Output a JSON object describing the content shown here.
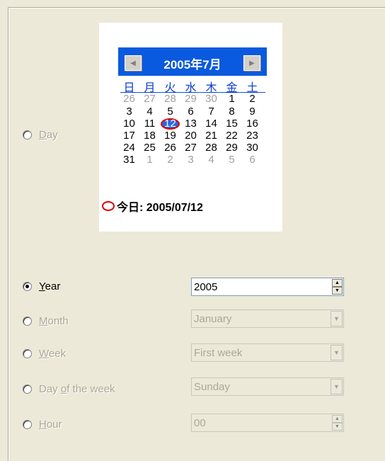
{
  "calendar": {
    "title": "2005年7月",
    "prev_icon": "left-arrow",
    "next_icon": "right-arrow",
    "weekdays": [
      "日",
      "月",
      "火",
      "水",
      "木",
      "金",
      "土"
    ],
    "weeks": [
      [
        "26",
        "27",
        "28",
        "29",
        "30",
        "1",
        "2"
      ],
      [
        "3",
        "4",
        "5",
        "6",
        "7",
        "8",
        "9"
      ],
      [
        "10",
        "11",
        "12",
        "13",
        "14",
        "15",
        "16"
      ],
      [
        "17",
        "18",
        "19",
        "20",
        "21",
        "22",
        "23"
      ],
      [
        "24",
        "25",
        "26",
        "27",
        "28",
        "29",
        "30"
      ],
      [
        "31",
        "1",
        "2",
        "3",
        "4",
        "5",
        "6"
      ]
    ],
    "today_label": "今日: 2005/07/12",
    "accent": "#0a5adf",
    "today_color": "#e00000"
  },
  "options": {
    "day": {
      "label_pre": "",
      "label_ul": "D",
      "label_post": "ay"
    },
    "year": {
      "label_pre": "",
      "label_ul": "Y",
      "label_post": "ear",
      "value": "2005"
    },
    "month": {
      "label_pre": "",
      "label_ul": "M",
      "label_post": "onth",
      "value": "January"
    },
    "week": {
      "label_pre": "",
      "label_ul": "W",
      "label_post": "eek",
      "value": "First week"
    },
    "dow": {
      "label_pre": "Day ",
      "label_ul": "o",
      "label_post": "f the week",
      "value": "Sunday"
    },
    "hour": {
      "label_pre": "",
      "label_ul": "H",
      "label_post": "our",
      "value": "00"
    }
  }
}
